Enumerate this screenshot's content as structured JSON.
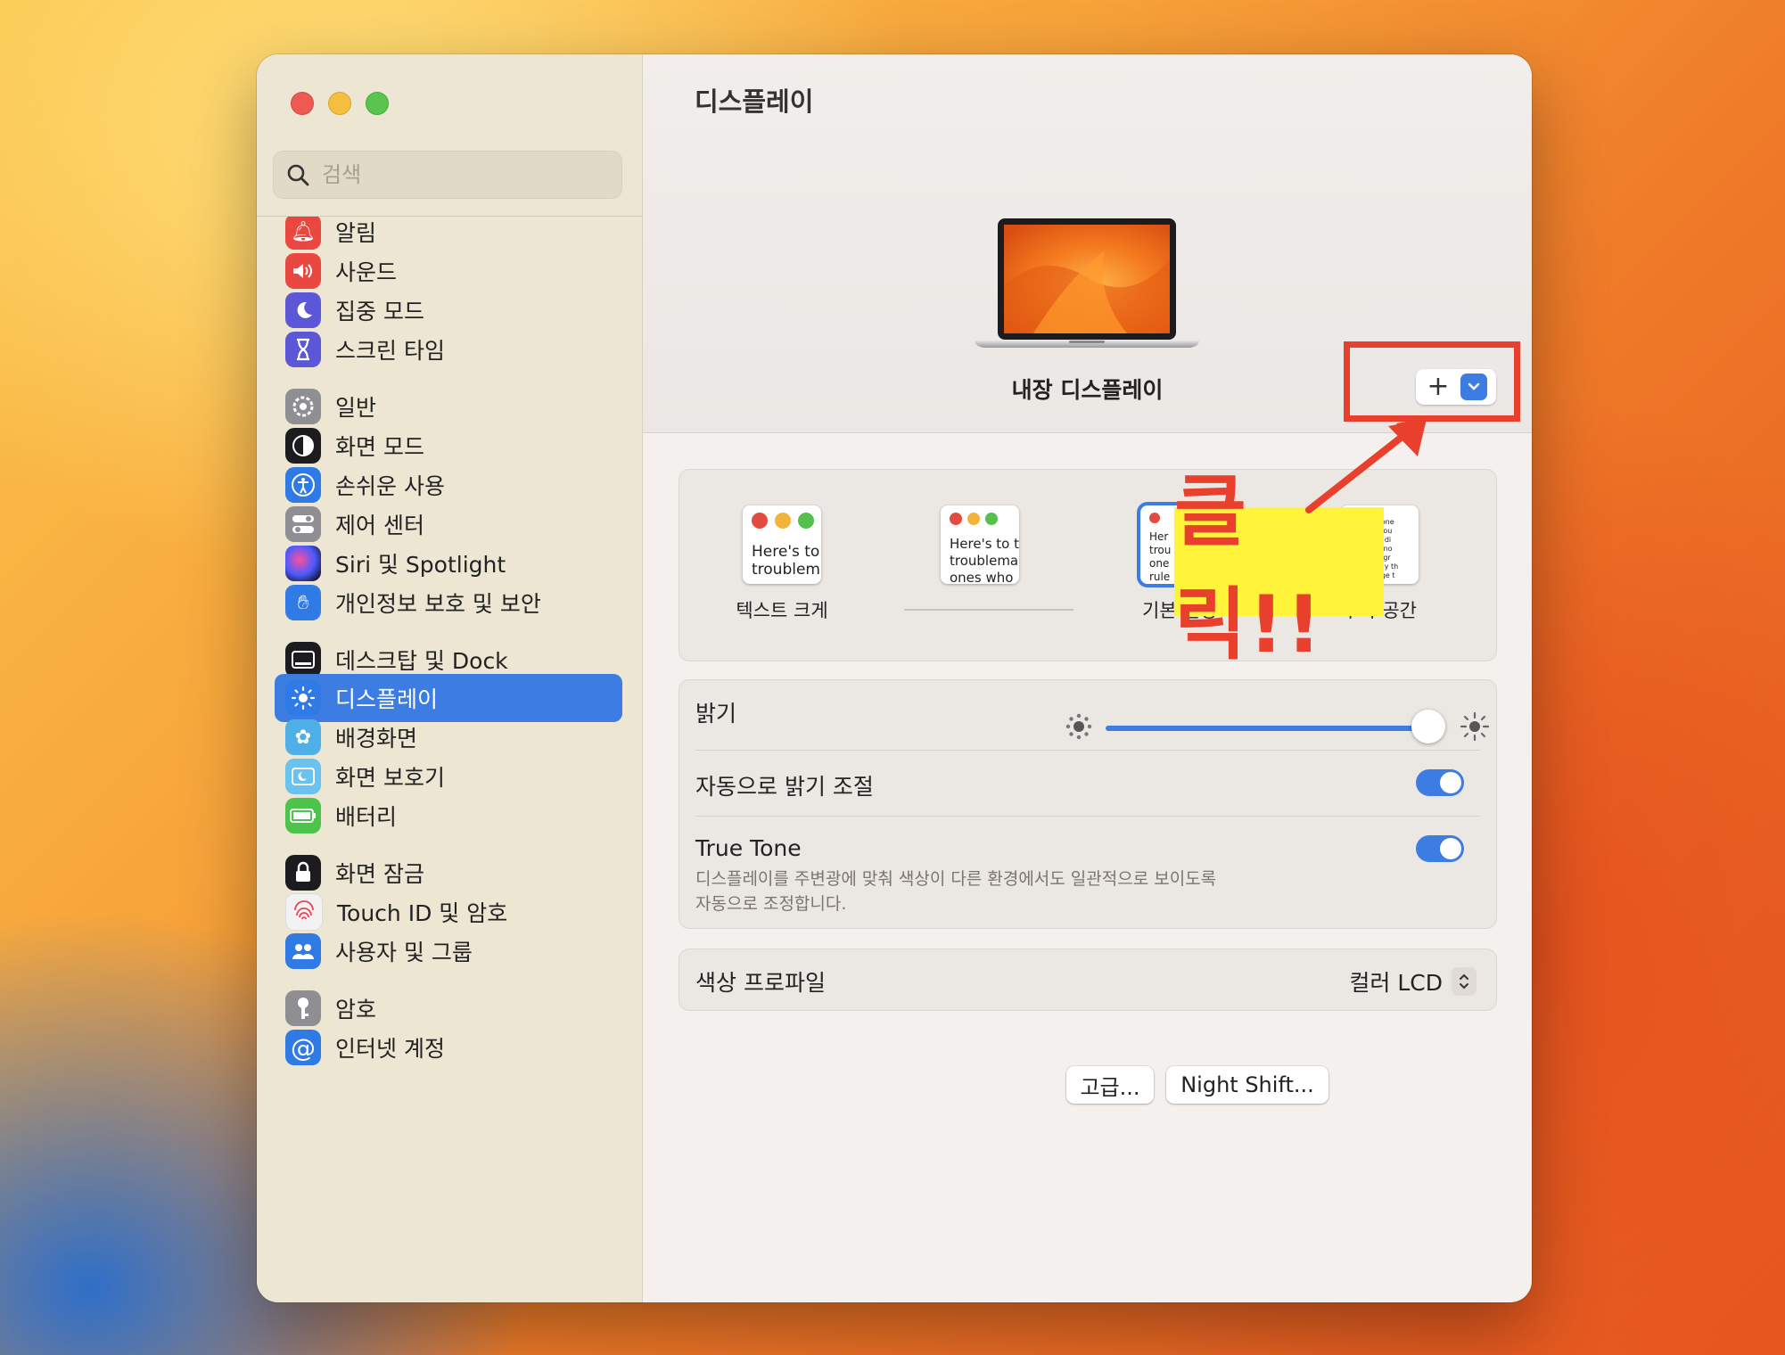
{
  "sidebar": {
    "search_placeholder": "검색",
    "items": [
      {
        "label": "알림",
        "icon": "bell-icon",
        "color": "#e9473f"
      },
      {
        "label": "사운드",
        "icon": "speaker-icon",
        "color": "#e9473f"
      },
      {
        "label": "집중 모드",
        "icon": "moon-icon",
        "color": "#5b57d6"
      },
      {
        "label": "스크린 타임",
        "icon": "hourglass-icon",
        "color": "#5b57d6"
      },
      {
        "label": "일반",
        "icon": "gear-icon",
        "color": "#8e8e93"
      },
      {
        "label": "화면 모드",
        "icon": "appearance-icon",
        "color": "#1c1c1e"
      },
      {
        "label": "손쉬운 사용",
        "icon": "accessibility-icon",
        "color": "#2f7ae5"
      },
      {
        "label": "제어 센터",
        "icon": "control-center-icon",
        "color": "#8e8e93"
      },
      {
        "label": "Siri 및 Spotlight",
        "icon": "siri-icon",
        "color": "#2b2b6a"
      },
      {
        "label": "개인정보 보호 및 보안",
        "icon": "hand-icon",
        "color": "#2f7ae5"
      },
      {
        "label": "데스크탑 및 Dock",
        "icon": "dock-icon",
        "color": "#1c1c1e"
      },
      {
        "label": "디스플레이",
        "icon": "sun-icon",
        "color": "#2f7ae5"
      },
      {
        "label": "배경화면",
        "icon": "flower-icon",
        "color": "#4fb0e8"
      },
      {
        "label": "화면 보호기",
        "icon": "screensaver-icon",
        "color": "#6ac3ee"
      },
      {
        "label": "배터리",
        "icon": "battery-icon",
        "color": "#4cc34a"
      },
      {
        "label": "화면 잠금",
        "icon": "lock-icon",
        "color": "#1c1c1e"
      },
      {
        "label": "Touch ID 및 암호",
        "icon": "fingerprint-icon",
        "color": "#f2f2f2"
      },
      {
        "label": "사용자 및 그룹",
        "icon": "users-icon",
        "color": "#2f7ae5"
      },
      {
        "label": "암호",
        "icon": "key-icon",
        "color": "#8e8e93"
      },
      {
        "label": "인터넷 계정",
        "icon": "at-icon",
        "color": "#2f7ae5"
      }
    ]
  },
  "main": {
    "title": "디스플레이",
    "display_name": "내장 디스플레이",
    "add_control": {
      "plus": "+",
      "chevron": "⌄"
    },
    "resolution": {
      "options": [
        {
          "sample": "Here's to\ntroublem",
          "label": "텍스트 크게"
        },
        {
          "sample": "Here's to t\ntroublema\nones who",
          "label": ""
        },
        {
          "sample": "Her\ntrou\none\nrule",
          "label": "기본 설정"
        },
        {
          "sample": "the crazy one\nkers. The rou\nsee things di\nthey have no\nthem, disagr\nbut the only th\nthey change t",
          "label": "추가 공간"
        }
      ]
    },
    "brightness_label": "밝기",
    "brightness_level": 0.95,
    "auto_brightness_label": "자동으로 밝기 조절",
    "auto_brightness_on": true,
    "true_tone_label": "True Tone",
    "true_tone_desc_line1": "디스플레이를 주변광에 맞춰 색상이 다른 환경에서도 일관적으로 보이도록",
    "true_tone_desc_line2": "자동으로 조정합니다.",
    "true_tone_on": true,
    "color_profile_label": "색상 프로파일",
    "color_profile_value": "컬러 LCD",
    "buttons": {
      "advanced": "고급...",
      "night_shift": "Night Shift...",
      "help": "?"
    }
  },
  "annotation": {
    "text": "클릭!!",
    "color": "#e8402c",
    "highlight": "#fff43a"
  }
}
